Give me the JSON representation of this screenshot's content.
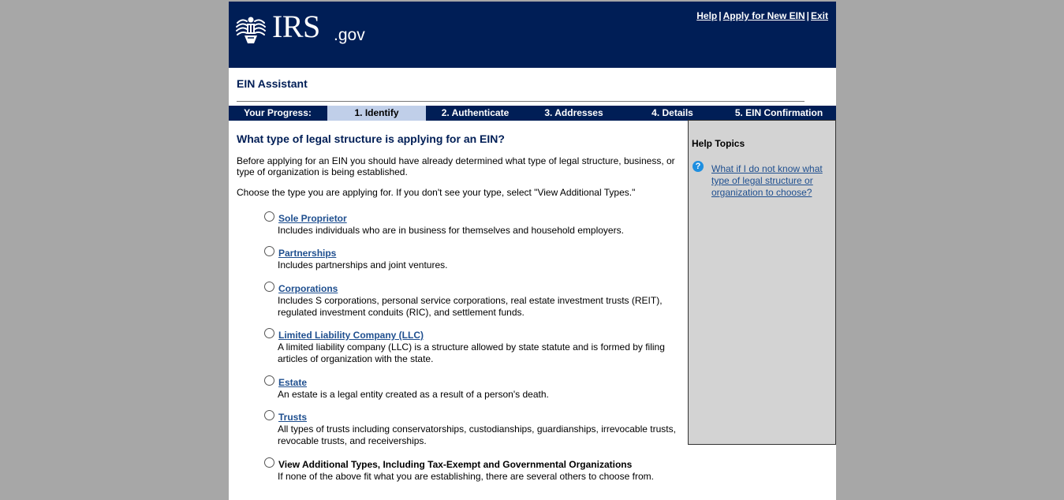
{
  "header": {
    "logo_text": "IRS",
    "logo_suffix": ".gov",
    "links": [
      "Help",
      "Apply for New EIN",
      "Exit"
    ],
    "separator": "|",
    "background": "#001e56"
  },
  "app_title": "EIN Assistant",
  "progress": {
    "label": "Your Progress:",
    "steps": [
      "1. Identify",
      "2. Authenticate",
      "3. Addresses",
      "4. Details",
      "5. EIN Confirmation"
    ],
    "active_step": "1. Identify",
    "active_color": "#c0cfe9"
  },
  "main": {
    "question": "What type of legal structure is applying for an EIN?",
    "intro": "Before applying for an EIN you should have already determined what type of legal structure, business, or type of organization is being established.",
    "choose": "Choose the type you are applying for. If you don't see your type, select \"View Additional Types.\"",
    "options": [
      {
        "title": "Sole Proprietor",
        "desc": "Includes individuals who are in business for themselves and household employers."
      },
      {
        "title": "Partnerships",
        "desc": "Includes partnerships and joint ventures."
      },
      {
        "title": "Corporations",
        "desc": "Includes S corporations, personal service corporations, real estate investment trusts (REIT), regulated investment conduits (RIC), and settlement funds."
      },
      {
        "title": "Limited Liability Company (LLC)",
        "desc": "A limited liability company (LLC) is a structure allowed by state statute and is formed by filing articles of organization with the state."
      },
      {
        "title": "Estate",
        "desc": "An estate is a legal entity created as a result of a person's death."
      },
      {
        "title": "Trusts",
        "desc": "All types of trusts including conservatorships, custodianships, guardianships, irrevocable trusts, revocable trusts, and receiverships."
      },
      {
        "title": "View Additional Types, Including Tax-Exempt and Governmental Organizations",
        "desc": "If none of the above fit what you are establishing, there are several others to choose from."
      }
    ]
  },
  "sidebar": {
    "heading": "Help Topics",
    "icon": "question-circle-icon",
    "link": "What if I do not know what type of legal structure or organization to choose?"
  }
}
